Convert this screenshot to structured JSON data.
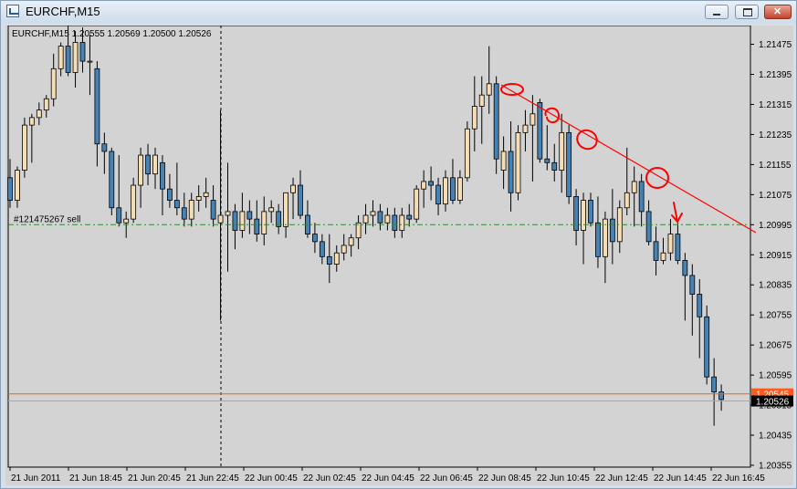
{
  "window": {
    "title": "EURCHF,M15"
  },
  "header": {
    "info": "EURCHF,M15  1.20555 1.20569 1.20500 1.20526"
  },
  "order_line": {
    "label": "#121475267 sell",
    "price": 1.20995,
    "color": "#2e8b2e"
  },
  "current_price": {
    "bid": "1.20526",
    "ask": "1.20545",
    "line_color": "#ff5a1f"
  },
  "colors": {
    "background": "#d3d3d3",
    "bull_body": "#f5deb3",
    "bear_body": "#4682b4",
    "wick": "#000000",
    "trendline": "#ff0000",
    "annotation": "#ff0000"
  },
  "chart_data": {
    "type": "candlestick",
    "symbol": "EURCHF",
    "timeframe": "M15",
    "ylim": [
      1.20355,
      1.2152
    ],
    "y_ticks": [
      "1.21475",
      "1.21395",
      "1.21315",
      "1.21235",
      "1.21155",
      "1.21075",
      "1.20995",
      "1.20915",
      "1.20835",
      "1.20755",
      "1.20675",
      "1.20595",
      "1.20515",
      "1.20435",
      "1.20355"
    ],
    "x_tick_labels": [
      "21 Jun 2011",
      "21 Jun 18:45",
      "21 Jun 20:45",
      "21 Jun 22:45",
      "22 Jun 00:45",
      "22 Jun 02:45",
      "22 Jun 04:45",
      "22 Jun 06:45",
      "22 Jun 08:45",
      "22 Jun 10:45",
      "22 Jun 12:45",
      "22 Jun 14:45",
      "22 Jun 16:45"
    ],
    "candles": [
      [
        1.2112,
        1.2117,
        1.2104,
        1.2106
      ],
      [
        1.2106,
        1.2115,
        1.2104,
        1.2114
      ],
      [
        1.2114,
        1.2128,
        1.2112,
        1.2126
      ],
      [
        1.2126,
        1.2129,
        1.2116,
        1.2128
      ],
      [
        1.2128,
        1.2132,
        1.2126,
        1.213
      ],
      [
        1.213,
        1.2134,
        1.2128,
        1.2133
      ],
      [
        1.2133,
        1.2145,
        1.2131,
        1.2141
      ],
      [
        1.2141,
        1.2148,
        1.2139,
        1.2147
      ],
      [
        1.2147,
        1.2154,
        1.2139,
        1.214
      ],
      [
        1.214,
        1.2151,
        1.2136,
        1.2148
      ],
      [
        1.2148,
        1.2152,
        1.214,
        1.2143
      ],
      [
        1.2143,
        1.215,
        1.2134,
        1.2143
      ],
      [
        1.2141,
        1.2143,
        1.2115,
        1.2121
      ],
      [
        1.2121,
        1.2124,
        1.2113,
        1.2119
      ],
      [
        1.2119,
        1.212,
        1.2102,
        1.2104
      ],
      [
        1.2104,
        1.2118,
        1.2099,
        1.21
      ],
      [
        1.21,
        1.2103,
        1.2096,
        1.2101
      ],
      [
        1.2101,
        1.2112,
        1.21,
        1.211
      ],
      [
        1.211,
        1.212,
        1.2104,
        1.2118
      ],
      [
        1.2118,
        1.2121,
        1.211,
        1.2113
      ],
      [
        1.2113,
        1.212,
        1.2109,
        1.2118
      ],
      [
        1.2116,
        1.2118,
        1.2102,
        1.2109
      ],
      [
        1.2109,
        1.2113,
        1.2104,
        1.2106
      ],
      [
        1.2106,
        1.2116,
        1.2102,
        1.2104
      ],
      [
        1.2104,
        1.2108,
        1.2099,
        1.2101
      ],
      [
        1.2101,
        1.2108,
        1.2099,
        1.2106
      ],
      [
        1.2106,
        1.211,
        1.2103,
        1.2107
      ],
      [
        1.2107,
        1.2112,
        1.2104,
        1.2108
      ],
      [
        1.2106,
        1.211,
        1.2099,
        1.2101
      ],
      [
        1.21,
        1.213,
        1.2074,
        1.2102
      ],
      [
        1.2102,
        1.2116,
        1.2087,
        1.2103
      ],
      [
        1.2103,
        1.2105,
        1.2093,
        1.2098
      ],
      [
        1.2098,
        1.2108,
        1.2096,
        1.2103
      ],
      [
        1.2103,
        1.2106,
        1.2097,
        1.2101
      ],
      [
        1.2101,
        1.2106,
        1.2095,
        1.2097
      ],
      [
        1.2097,
        1.2107,
        1.2094,
        1.2103
      ],
      [
        1.2103,
        1.2106,
        1.21,
        1.2104
      ],
      [
        1.2103,
        1.2105,
        1.2097,
        1.2099
      ],
      [
        1.2099,
        1.2108,
        1.2096,
        1.2108
      ],
      [
        1.2108,
        1.2112,
        1.2101,
        1.211
      ],
      [
        1.211,
        1.2114,
        1.2101,
        1.2102
      ],
      [
        1.2102,
        1.2106,
        1.2096,
        1.2097
      ],
      [
        1.2097,
        1.21,
        1.2092,
        1.2095
      ],
      [
        1.2095,
        1.2097,
        1.2089,
        1.2091
      ],
      [
        1.2091,
        1.2097,
        1.2084,
        1.2089
      ],
      [
        1.2089,
        1.2094,
        1.2087,
        1.2092
      ],
      [
        1.2092,
        1.2097,
        1.209,
        1.2094
      ],
      [
        1.2094,
        1.2097,
        1.2091,
        1.2096
      ],
      [
        1.2096,
        1.2102,
        1.2093,
        1.21
      ],
      [
        1.21,
        1.2105,
        1.2097,
        1.2102
      ],
      [
        1.2102,
        1.2106,
        1.2099,
        1.2103
      ],
      [
        1.2103,
        1.2105,
        1.2098,
        1.21
      ],
      [
        1.21,
        1.2104,
        1.2098,
        1.2102
      ],
      [
        1.2102,
        1.2104,
        1.2096,
        1.2098
      ],
      [
        1.2098,
        1.2104,
        1.2096,
        1.2102
      ],
      [
        1.2102,
        1.2105,
        1.2099,
        1.2101
      ],
      [
        1.2101,
        1.211,
        1.21,
        1.2109
      ],
      [
        1.2109,
        1.2114,
        1.2104,
        1.2111
      ],
      [
        1.2111,
        1.2115,
        1.2106,
        1.211
      ],
      [
        1.211,
        1.2112,
        1.2102,
        1.2105
      ],
      [
        1.2105,
        1.2114,
        1.2103,
        1.2112
      ],
      [
        1.2112,
        1.2117,
        1.2105,
        1.2106
      ],
      [
        1.2106,
        1.2114,
        1.2105,
        1.2112
      ],
      [
        1.2112,
        1.2127,
        1.2111,
        1.2125
      ],
      [
        1.2125,
        1.2139,
        1.2119,
        1.2131
      ],
      [
        1.2131,
        1.2139,
        1.2121,
        1.2134
      ],
      [
        1.2134,
        1.2147,
        1.2129,
        1.2137
      ],
      [
        1.2137,
        1.2139,
        1.2113,
        1.2117
      ],
      [
        1.2114,
        1.2123,
        1.2109,
        1.2119
      ],
      [
        1.2119,
        1.2127,
        1.2103,
        1.2108
      ],
      [
        1.2108,
        1.2126,
        1.2106,
        1.2124
      ],
      [
        1.2124,
        1.213,
        1.2119,
        1.2126
      ],
      [
        1.2126,
        1.2134,
        1.2111,
        1.2129
      ],
      [
        1.2132,
        1.2133,
        1.2116,
        1.2117
      ],
      [
        1.2117,
        1.2126,
        1.2114,
        1.2116
      ],
      [
        1.2116,
        1.2121,
        1.2111,
        1.2114
      ],
      [
        1.2114,
        1.2129,
        1.2108,
        1.2124
      ],
      [
        1.2124,
        1.2126,
        1.2105,
        1.2107
      ],
      [
        1.2107,
        1.2109,
        1.2094,
        1.2098
      ],
      [
        1.2098,
        1.2108,
        1.2089,
        1.2106
      ],
      [
        1.2106,
        1.2108,
        1.2099,
        1.21
      ],
      [
        1.21,
        1.2107,
        1.2088,
        1.2091
      ],
      [
        1.2091,
        1.2103,
        1.2084,
        1.2101
      ],
      [
        1.2101,
        1.2109,
        1.2089,
        1.2095
      ],
      [
        1.2095,
        1.2106,
        1.2092,
        1.2104
      ],
      [
        1.2104,
        1.212,
        1.2102,
        1.2108
      ],
      [
        1.2108,
        1.2115,
        1.2099,
        1.2111
      ],
      [
        1.2111,
        1.2113,
        1.2099,
        1.2103
      ],
      [
        1.2103,
        1.2106,
        1.2094,
        1.2095
      ],
      [
        1.2095,
        1.2099,
        1.2086,
        1.209
      ],
      [
        1.209,
        1.2096,
        1.2089,
        1.2092
      ],
      [
        1.2092,
        1.2101,
        1.209,
        1.2097
      ],
      [
        1.2097,
        1.21,
        1.2089,
        1.209
      ],
      [
        1.209,
        1.2092,
        1.2074,
        1.2086
      ],
      [
        1.2086,
        1.2089,
        1.207,
        1.2081
      ],
      [
        1.2081,
        1.2085,
        1.2064,
        1.2075
      ],
      [
        1.2075,
        1.2078,
        1.2057,
        1.2059
      ],
      [
        1.2059,
        1.2064,
        1.2046,
        1.2055
      ],
      [
        1.2055,
        1.2057,
        1.205,
        1.2053
      ]
    ]
  }
}
